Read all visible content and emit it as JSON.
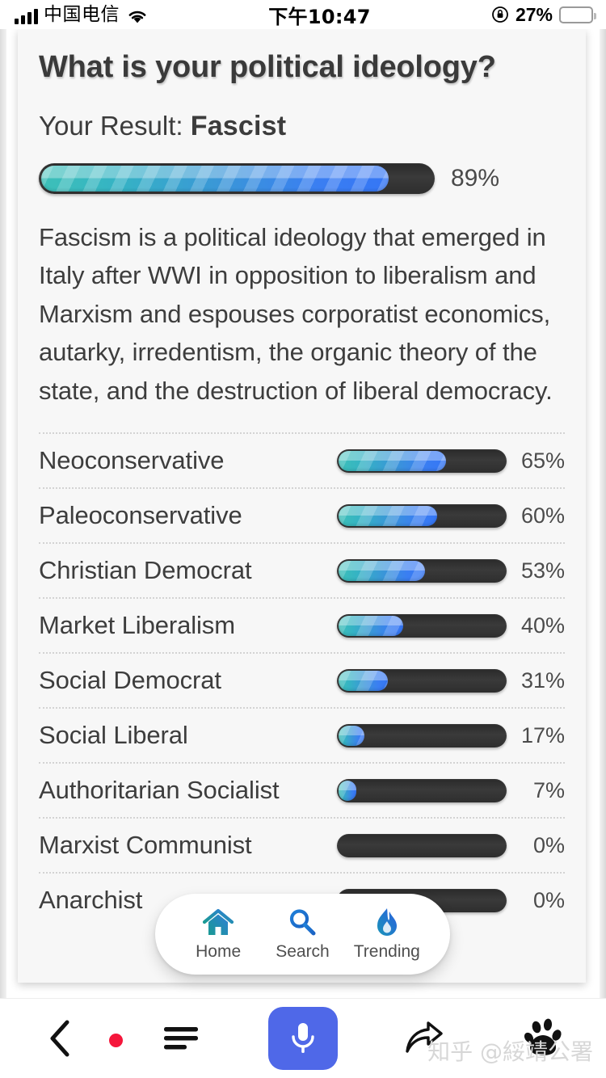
{
  "status_bar": {
    "carrier": "中国电信",
    "time": "下午10:47",
    "battery_percent": "27%",
    "signal_icon": "signal-bars-icon",
    "wifi_icon": "wifi-icon",
    "rotation_lock_icon": "rotation-lock-icon",
    "battery_icon": "battery-icon",
    "battery_level": 27,
    "battery_color": "#ffcc00"
  },
  "quiz": {
    "title": "What is your political ideology?",
    "result_prefix": "Your Result: ",
    "result_value": "Fascist",
    "result_percent": "89%",
    "result_percent_value": 89,
    "description": "Fascism is a political ideology that emerged in Italy after WWI in opposition to liberalism and Marxism and espouses corporatist economics, autarky, irredentism, the organic theory of the state, and the destruction of liberal democracy."
  },
  "chart_data": {
    "type": "bar",
    "title": "What is your political ideology?",
    "xlabel": "",
    "ylabel": "",
    "xlim": [
      0,
      100
    ],
    "orientation": "horizontal",
    "grid": false,
    "legend": null,
    "categories": [
      "Fascist",
      "Neoconservative",
      "Paleoconservative",
      "Christian Democrat",
      "Market Liberalism",
      "Social Democrat",
      "Social Liberal",
      "Authoritarian Socialist",
      "Marxist Communist",
      "Anarchist"
    ],
    "values": [
      89,
      65,
      60,
      53,
      40,
      31,
      17,
      7,
      0,
      0
    ],
    "value_labels": [
      "89%",
      "65%",
      "60%",
      "53%",
      "40%",
      "31%",
      "17%",
      "7%",
      "0%",
      "0%"
    ]
  },
  "results": [
    {
      "label": "Neoconservative",
      "percent": "65%",
      "value": 65
    },
    {
      "label": "Paleoconservative",
      "percent": "60%",
      "value": 60
    },
    {
      "label": "Christian Democrat",
      "percent": "53%",
      "value": 53
    },
    {
      "label": "Market Liberalism",
      "percent": "40%",
      "value": 40
    },
    {
      "label": "Social Democrat",
      "percent": "31%",
      "value": 31
    },
    {
      "label": "Social Liberal",
      "percent": "17%",
      "value": 17
    },
    {
      "label": "Authoritarian Socialist",
      "percent": "7%",
      "value": 7
    },
    {
      "label": "Marxist Communist",
      "percent": "0%",
      "value": 0
    },
    {
      "label": "Anarchist",
      "percent": "0%",
      "value": 0
    }
  ],
  "bottom_nav": {
    "items": [
      {
        "label": "Home",
        "icon": "home-icon"
      },
      {
        "label": "Search",
        "icon": "search-icon"
      },
      {
        "label": "Trending",
        "icon": "flame-icon"
      }
    ]
  },
  "browser_toolbar": {
    "back_icon": "back-chevron-icon",
    "menu_icon": "menu-lines-icon",
    "menu_badge": true,
    "mic_icon": "microphone-icon",
    "mic_color": "#4f68e8",
    "share_icon": "share-arrow-icon",
    "account_icon": "baidu-paw-icon"
  },
  "watermark": "知乎 @綏靖公署",
  "colors": {
    "bar_track": "#333333",
    "bar_fill_start": "#3dc0b8",
    "bar_fill_end": "#3576f5",
    "card_bg": "#f7f7f7",
    "text": "#3d3d3d"
  }
}
